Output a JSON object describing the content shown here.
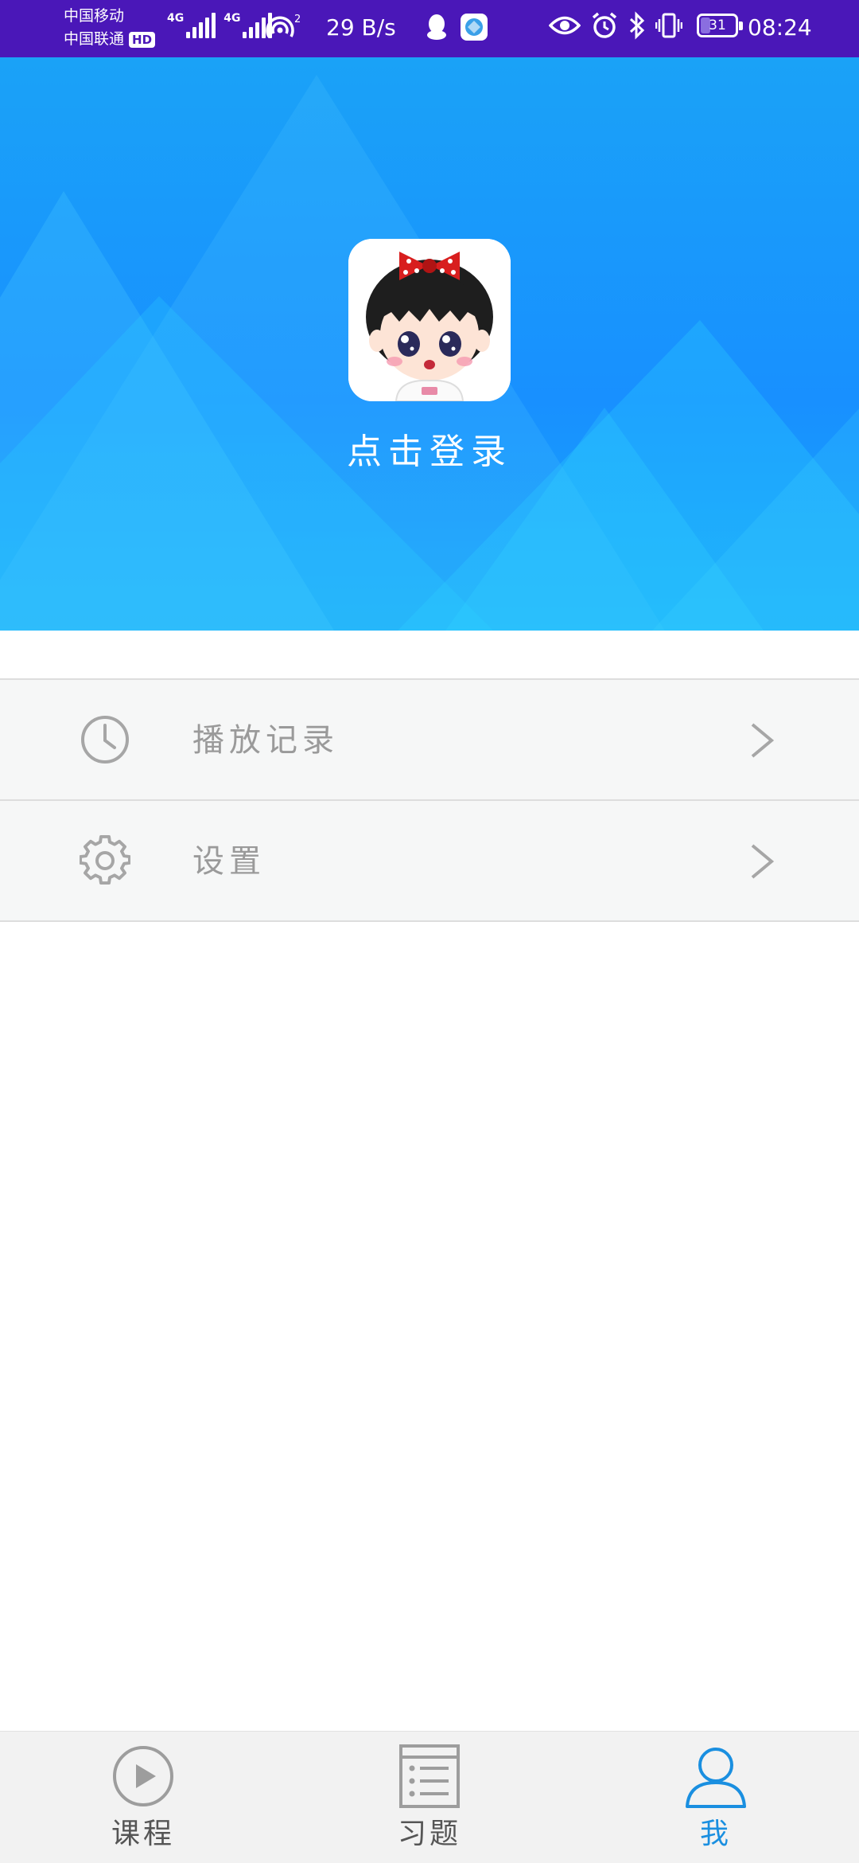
{
  "status_bar": {
    "carrier_1": "中国移动",
    "carrier_2": "中国联通",
    "hd_badge": "HD",
    "net_type_1": "4G",
    "net_type_2": "4G",
    "hotspot_count": "2",
    "net_speed": "29 B/s",
    "battery_level": "31",
    "battery_percent": 31,
    "time": "08:24"
  },
  "header": {
    "login_text": "点击登录",
    "banner_color": "#1890ff"
  },
  "menu": {
    "items": [
      {
        "icon": "clock-icon",
        "label": "播放记录"
      },
      {
        "icon": "gear-icon",
        "label": "设置"
      }
    ]
  },
  "bottom_nav": {
    "tabs": [
      {
        "icon": "play-circle-icon",
        "label": "课程",
        "active": false
      },
      {
        "icon": "list-icon",
        "label": "习题",
        "active": false
      },
      {
        "icon": "user-icon",
        "label": "我",
        "active": true
      }
    ],
    "active_color": "#1a8fe0"
  }
}
